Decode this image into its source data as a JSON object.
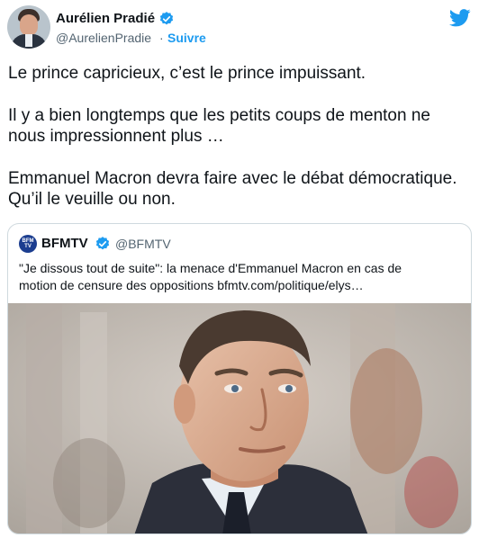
{
  "author": {
    "name": "Aurélien Pradié",
    "handle": "@AurelienPradie",
    "separator": "·",
    "follow_label": "Suivre",
    "avatar_icon": "profile-photo-avatar",
    "verified_icon": "verified-badge-icon"
  },
  "tweet": {
    "paragraphs": [
      [
        "Le prince capricieux, c’est le prince impuissant."
      ],
      [
        "Il y a bien longtemps que les petits coups de menton ne",
        "nous impressionnent plus …"
      ],
      [
        "Emmanuel Macron devra faire avec le débat démocratique.",
        "Qu’il le veuille ou non."
      ]
    ]
  },
  "quoted": {
    "name": "BFMTV",
    "handle": "@BFMTV",
    "avatar_text": "BFM TV",
    "text_lines": [
      "\"Je dissous tout de suite\": la menace d'Emmanuel Macron en cas de",
      "motion de censure des oppositions bfmtv.com/politique/elys…"
    ],
    "image_icon": "portrait-photo"
  },
  "colors": {
    "accent": "#1d9bf0",
    "text": "#0f1419",
    "secondary": "#536471",
    "border": "#cfd9de"
  },
  "brand_icon": "twitter-bird-icon"
}
